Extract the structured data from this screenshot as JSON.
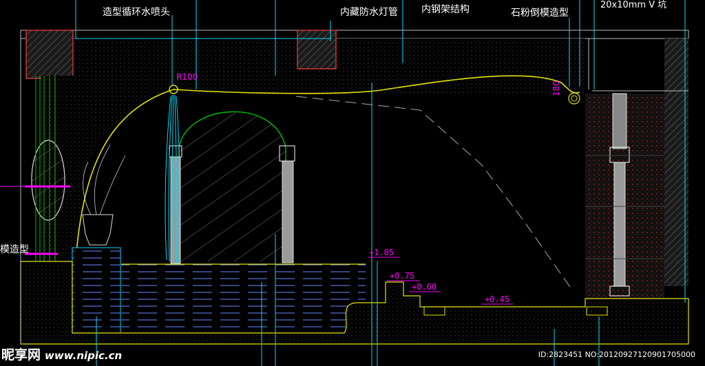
{
  "labels": {
    "nozzle": "造型循环水喷头",
    "hidden_tube": "内藏防水灯管",
    "steel_frame": "内钢架结构",
    "stone_mold": "石粉倒模造型",
    "groove": "20x10mm V 坑",
    "left_cut": "模造型"
  },
  "dimensions": {
    "radius": "R100",
    "height180": "180"
  },
  "elevations": [
    "+1.05",
    "+0.75",
    "+0.60",
    "+0.45"
  ],
  "colors": {
    "accent": "#ff00ff",
    "line_yellow": "#ffff00",
    "line_cyan": "#00ffff",
    "line_green": "#00cc00",
    "line_red": "#ff0000"
  },
  "watermark": {
    "brand": "昵享网",
    "url": "www.nipic.cn",
    "id": "ID:2823451 NO:20120927120901705000"
  }
}
